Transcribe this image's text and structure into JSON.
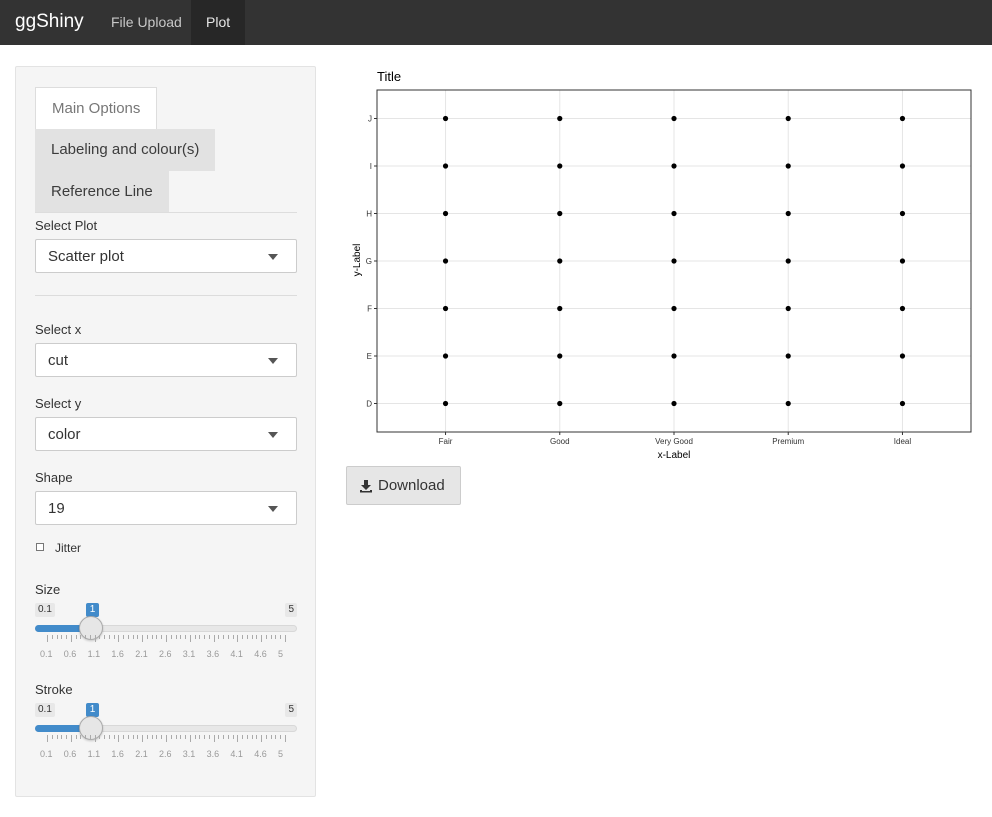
{
  "app": {
    "brand": "ggShiny"
  },
  "nav": {
    "items": [
      {
        "label": "File Upload"
      },
      {
        "label": "Plot"
      }
    ]
  },
  "sidebar": {
    "tabs": [
      {
        "label": "Main Options"
      },
      {
        "label": "Labeling and colour(s)"
      },
      {
        "label": "Reference Line"
      }
    ],
    "plot_select": {
      "label": "Select Plot",
      "value": "Scatter plot"
    },
    "x_select": {
      "label": "Select x",
      "value": "cut"
    },
    "y_select": {
      "label": "Select y",
      "value": "color"
    },
    "shape_select": {
      "label": "Shape",
      "value": "19"
    },
    "jitter": {
      "label": "Jitter",
      "checked": false
    },
    "size_slider": {
      "label": "Size",
      "min": "0.1",
      "max": "5",
      "value": 1,
      "current_label": "1",
      "ticks": [
        "0.1",
        "0.6",
        "1.1",
        "1.6",
        "2.1",
        "2.6",
        "3.1",
        "3.6",
        "4.1",
        "4.6",
        "5"
      ]
    },
    "stroke_slider": {
      "label": "Stroke",
      "min": "0.1",
      "max": "5",
      "value": 1,
      "current_label": "1",
      "ticks": [
        "0.1",
        "0.6",
        "1.1",
        "1.6",
        "2.1",
        "2.6",
        "3.1",
        "3.6",
        "4.1",
        "4.6",
        "5"
      ]
    }
  },
  "download": {
    "label": "Download",
    "icon": "download-icon"
  },
  "chart_data": {
    "type": "scatter",
    "title": "Title",
    "xlabel": "x-Label",
    "ylabel": "y-Label",
    "categories_x": [
      "Fair",
      "Good",
      "Very Good",
      "Premium",
      "Ideal"
    ],
    "categories_y": [
      "D",
      "E",
      "F",
      "G",
      "H",
      "I",
      "J"
    ],
    "points": [
      [
        "Fair",
        "D"
      ],
      [
        "Fair",
        "E"
      ],
      [
        "Fair",
        "F"
      ],
      [
        "Fair",
        "G"
      ],
      [
        "Fair",
        "H"
      ],
      [
        "Fair",
        "I"
      ],
      [
        "Fair",
        "J"
      ],
      [
        "Good",
        "D"
      ],
      [
        "Good",
        "E"
      ],
      [
        "Good",
        "F"
      ],
      [
        "Good",
        "G"
      ],
      [
        "Good",
        "H"
      ],
      [
        "Good",
        "I"
      ],
      [
        "Good",
        "J"
      ],
      [
        "Very Good",
        "D"
      ],
      [
        "Very Good",
        "E"
      ],
      [
        "Very Good",
        "F"
      ],
      [
        "Very Good",
        "G"
      ],
      [
        "Very Good",
        "H"
      ],
      [
        "Very Good",
        "I"
      ],
      [
        "Very Good",
        "J"
      ],
      [
        "Premium",
        "D"
      ],
      [
        "Premium",
        "E"
      ],
      [
        "Premium",
        "F"
      ],
      [
        "Premium",
        "G"
      ],
      [
        "Premium",
        "H"
      ],
      [
        "Premium",
        "I"
      ],
      [
        "Premium",
        "J"
      ],
      [
        "Ideal",
        "D"
      ],
      [
        "Ideal",
        "E"
      ],
      [
        "Ideal",
        "F"
      ],
      [
        "Ideal",
        "G"
      ],
      [
        "Ideal",
        "H"
      ],
      [
        "Ideal",
        "I"
      ],
      [
        "Ideal",
        "J"
      ]
    ],
    "grid": true
  }
}
